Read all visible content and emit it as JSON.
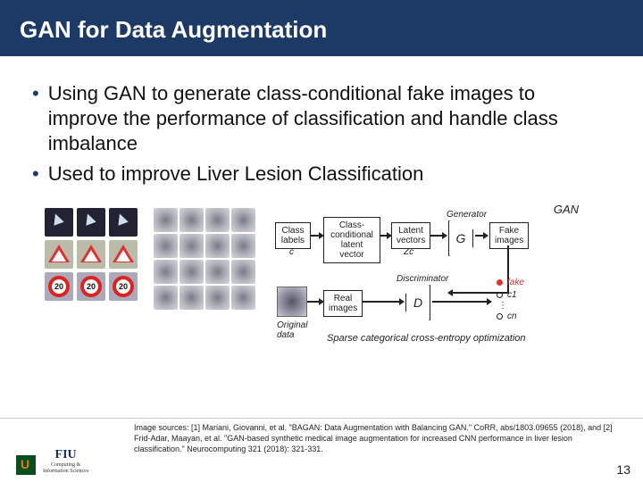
{
  "title": "GAN for Data Augmentation",
  "bullets": [
    "Using GAN to generate class-conditional fake images to improve the performance of classification and handle class imbalance",
    "Used to improve Liver Lesion Classification"
  ],
  "gan": {
    "title": "GAN",
    "class_labels_box": "Class\nlabels",
    "class_labels_var": "c",
    "cond_box": "Class-\nconditional\nlatent vector",
    "latent_box": "Latent\nvectors",
    "latent_var": "Zc",
    "generator_label": "Generator",
    "g_symbol": "G",
    "fake_box": "Fake\nimages",
    "real_box": "Real\nimages",
    "discriminator_label": "Discriminator",
    "d_symbol": "D",
    "original_label": "Original\ndata",
    "out_fake": "fake",
    "out_c1": "c1",
    "out_cn": "cn",
    "caption": "Sparse categorical cross-entropy optimization"
  },
  "speed_value": "20",
  "citation": "Image sources: [1] Mariani, Giovanni, et al. \"BAGAN: Data Augmentation with Balancing GAN.\" CoRR, abs/1803.09655 (2018), and [2] Frid-Adar, Maayan, et al. \"GAN-based synthetic medical image augmentation for increased CNN performance in liver lesion classification.\" Neurocomputing 321 (2018): 321-331.",
  "fiu_name": "FIU",
  "fiu_sub": "Computing &\nInformation Sciences",
  "page_number": "13"
}
